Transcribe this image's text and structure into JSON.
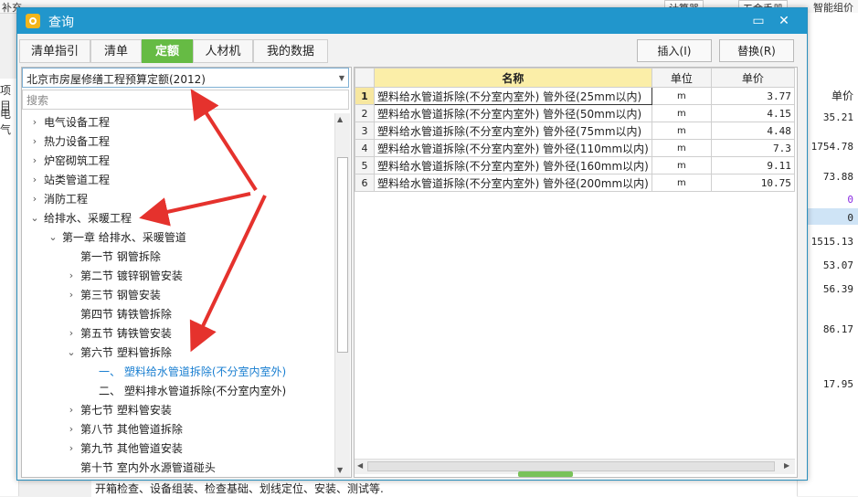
{
  "background": {
    "top_left": "补充",
    "top_btn1": "计算器",
    "top_btn2": "五金手册",
    "top_right": "智能组价",
    "left_header": "项目",
    "left_item": "电气",
    "right_header": "单价",
    "right_values": [
      "35.21",
      "1754.78",
      "73.88",
      "0",
      "0",
      "1515.13",
      "53.07",
      "56.39",
      "86.17",
      "17.95"
    ],
    "bottom_text": "开箱检查、设备组装、检查基础、划线定位、安装、测试等."
  },
  "dialog": {
    "title": "查询",
    "minimize": "▭",
    "close": "✕",
    "tabs": [
      {
        "label": "清单指引"
      },
      {
        "label": "清单"
      },
      {
        "label": "定额"
      },
      {
        "label": "人材机"
      },
      {
        "label": "我的数据"
      }
    ],
    "insert_btn": "插入(I)",
    "replace_btn": "替换(R)",
    "combo_value": "北京市房屋修缮工程预算定额(2012)",
    "search_placeholder": "搜索",
    "tree": [
      {
        "label": "电气设备工程",
        "toggle": "›"
      },
      {
        "label": "热力设备工程",
        "toggle": "›"
      },
      {
        "label": "炉窑砌筑工程",
        "toggle": "›"
      },
      {
        "label": "站类管道工程",
        "toggle": "›"
      },
      {
        "label": "消防工程",
        "toggle": "›"
      },
      {
        "label": "给排水、采暖工程",
        "toggle": "⌄"
      },
      {
        "label": "第一章  给排水、采暖管道",
        "toggle": "⌄"
      },
      {
        "label": "第一节  钢管拆除",
        "toggle": ""
      },
      {
        "label": "第二节  镀锌钢管安装",
        "toggle": "›"
      },
      {
        "label": "第三节  钢管安装",
        "toggle": "›"
      },
      {
        "label": "第四节  铸铁管拆除",
        "toggle": ""
      },
      {
        "label": "第五节  铸铁管安装",
        "toggle": "›"
      },
      {
        "label": "第六节  塑料管拆除",
        "toggle": "⌄"
      },
      {
        "label": "一、  塑料给水管道拆除(不分室内室外)",
        "toggle": ""
      },
      {
        "label": "二、  塑料排水管道拆除(不分室内室外)",
        "toggle": ""
      },
      {
        "label": "第七节  塑料管安装",
        "toggle": "›"
      },
      {
        "label": "第八节  其他管道拆除",
        "toggle": "›"
      },
      {
        "label": "第九节  其他管道安装",
        "toggle": "›"
      },
      {
        "label": "第十节  室内外水源管道碰头",
        "toggle": ""
      }
    ],
    "grid": {
      "headers": {
        "name": "名称",
        "unit": "单位",
        "price": "单价"
      },
      "rows": [
        {
          "no": "1",
          "name": "塑料给水管道拆除(不分室内室外) 管外径(25mm以内)",
          "unit": "m",
          "price": "3.77"
        },
        {
          "no": "2",
          "name": "塑料给水管道拆除(不分室内室外) 管外径(50mm以内)",
          "unit": "m",
          "price": "4.15"
        },
        {
          "no": "3",
          "name": "塑料给水管道拆除(不分室内室外) 管外径(75mm以内)",
          "unit": "m",
          "price": "4.48"
        },
        {
          "no": "4",
          "name": "塑料给水管道拆除(不分室内室外) 管外径(110mm以内)",
          "unit": "m",
          "price": "7.3"
        },
        {
          "no": "5",
          "name": "塑料给水管道拆除(不分室内室外) 管外径(160mm以内)",
          "unit": "m",
          "price": "9.11"
        },
        {
          "no": "6",
          "name": "塑料给水管道拆除(不分室内室外) 管外径(200mm以内)",
          "unit": "m",
          "price": "10.75"
        }
      ]
    }
  },
  "colors": {
    "title_bar": "#2196cc",
    "active_tab": "#66bb44",
    "selected_text": "#1a7fd1",
    "annotation_arrow": "#e5322d"
  }
}
